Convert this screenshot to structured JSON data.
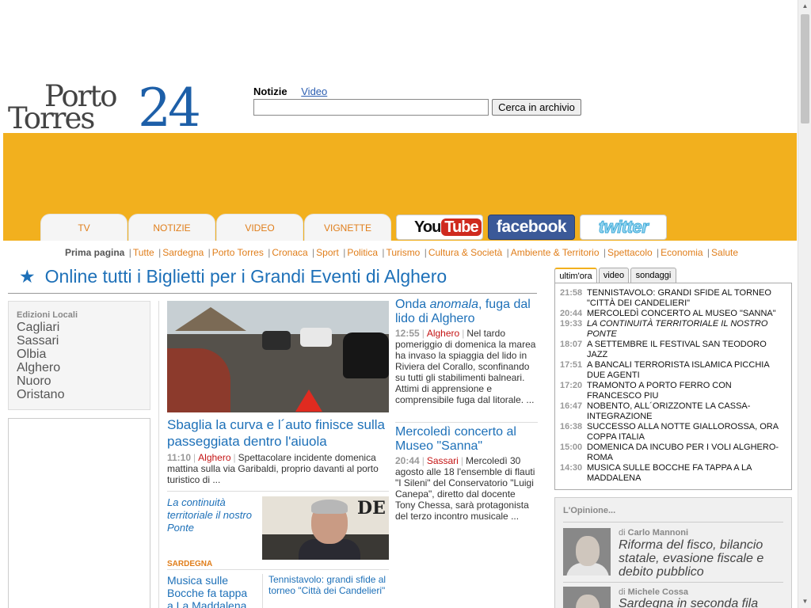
{
  "logo": {
    "line1": "Porto",
    "line2": "Torres",
    "number": "24"
  },
  "search": {
    "tab_active": "Notizie",
    "tab_link": "Video",
    "input_value": "",
    "button_label": "Cerca in archivio"
  },
  "nav": {
    "tabs": [
      "TV",
      "NOTIZIE",
      "VIDEO",
      "VIGNETTE"
    ],
    "youtube": {
      "you": "You",
      "tube": "Tube"
    },
    "facebook": "facebook",
    "twitter": "twitter"
  },
  "categories": {
    "first": "Prima pagina",
    "items": [
      "Tutte",
      "Sardegna",
      "Porto Torres",
      "Cronaca",
      "Sport",
      "Politica",
      "Turismo",
      "Cultura & Società",
      "Ambiente & Territorio",
      "Spettacolo",
      "Economia",
      "Salute"
    ]
  },
  "promo": {
    "star": "★",
    "text": "Online tutti i Biglietti per i Grandi Eventi di Alghero"
  },
  "editions": {
    "title": "Edizioni Locali",
    "items": [
      "Cagliari",
      "Sassari",
      "Olbia",
      "Alghero",
      "Nuoro",
      "Oristano"
    ]
  },
  "main_story": {
    "title": "Sbaglia la curva e l´auto finisce sulla passeggiata dentro l'aiuola",
    "time": "11:10",
    "place": "Alghero",
    "text": "Spettacolare incidente domenica mattina sulla via Garibaldi, proprio davanti al porto turistico di ..."
  },
  "second_story": {
    "title": "La continuità territoriale il nostro Ponte",
    "photo_text": "DE"
  },
  "section_label": "SARDEGNA",
  "third_story": {
    "title": "Musica sulle Bocche fa tappa a La Maddalena"
  },
  "fourth_story": {
    "title": "Tennistavolo: grandi sfide al torneo \"Città dei Candelieri\""
  },
  "mid_stories": [
    {
      "title_pre": "Onda ",
      "title_em": "anomala",
      "title_post": ", fuga dal lido di Alghero",
      "time": "12:55",
      "place": "Alghero",
      "text": "Nel tardo pomeriggio di domenica la marea ha invaso la spiaggia del lido in Riviera del Corallo, sconfinando su tutti gli stabilimenti balneari. Attimi di apprensione e comprensibile fuga dal litorale. ..."
    },
    {
      "title": "Mercoledì concerto al Museo \"Sanna\"",
      "time": "20:44",
      "place": "Sassari",
      "text": "Mercoledì 30 agosto alle 18 l'ensemble di flauti \"I Sileni\" del Conservatorio \"Luigi Canepa\", diretto dal docente Tony Chessa, sarà protagonista del terzo incontro musicale ..."
    }
  ],
  "right_tabs": [
    "ultim'ora",
    "video",
    "sondaggi"
  ],
  "ultimora": [
    {
      "time": "21:58",
      "text": "TENNISTAVOLO: GRANDI SFIDE AL TORNEO \"CITTÀ DEI CANDELIERI\"",
      "italic": false
    },
    {
      "time": "20:44",
      "text": "MERCOLEDÌ CONCERTO AL MUSEO \"SANNA\"",
      "italic": false
    },
    {
      "time": "19:33",
      "text": "LA CONTINUITÀ TERRITORIALE IL NOSTRO PONTE",
      "italic": true
    },
    {
      "time": "18:07",
      "text": "A SETTEMBRE IL FESTIVAL SAN TEODORO JAZZ",
      "italic": false
    },
    {
      "time": "17:51",
      "text": "A BANCALI TERRORISTA ISLAMICA PICCHIA DUE AGENTI",
      "italic": false
    },
    {
      "time": "17:20",
      "text": "TRAMONTO A PORTO FERRO CON FRANCESCO PIU",
      "italic": false
    },
    {
      "time": "16:47",
      "text": "NOBENTO, ALL´ORIZZONTE LA CASSA-INTEGRAZIONE",
      "italic": false
    },
    {
      "time": "16:38",
      "text": "SUCCESSO ALLA NOTTE GIALLOROSSA, ORA COPPA ITALIA",
      "italic": false
    },
    {
      "time": "15:00",
      "text": "DOMENICA DA INCUBO PER I VOLI ALGHERO-ROMA",
      "italic": false
    },
    {
      "time": "14:30",
      "text": "MUSICA SULLE BOCCHE FA TAPPA A LA MADDALENA",
      "italic": false
    }
  ],
  "opinione": {
    "title": "L'Opinione...",
    "items": [
      {
        "by": "di",
        "author": "Carlo Mannoni",
        "headline": "Riforma del fisco, bilancio statale, evasione fiscale e debito pubblico"
      },
      {
        "by": "di",
        "author": "Michele Cossa",
        "headline": "Sardegna in seconda fila"
      }
    ]
  }
}
